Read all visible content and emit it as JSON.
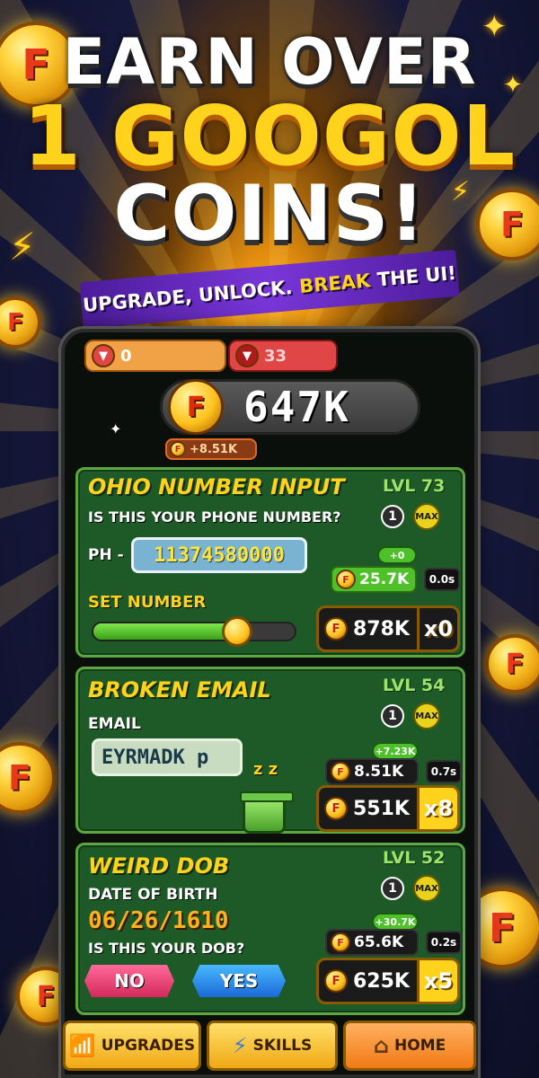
{
  "headline": {
    "line1": "EARN OVER",
    "line2": "1 GOOGOL",
    "line3": "COINS!",
    "banner_a": "UPGRADE, UNLOCK.",
    "banner_b": "BREAK",
    "banner_c": "THE UI!"
  },
  "coin_glyph": "F",
  "counters": {
    "orange_value": "0",
    "red_value": "33"
  },
  "balance": {
    "value": "647K",
    "rate": "+8.51K"
  },
  "cards": [
    {
      "title": "OHIO NUMBER INPUT",
      "level": "LVL 73",
      "question": "IS THIS YOUR PHONE NUMBER?",
      "count": "1",
      "max": "MAX",
      "phone_prefix": "PH -",
      "phone_value": "11374580000",
      "plus": "+0",
      "rate_cost": "25.7K",
      "time": "0.0s",
      "slider_label": "SET NUMBER",
      "slider_value": 0.71,
      "buy_cost": "878K",
      "multiplier": "x0"
    },
    {
      "title": "BROKEN EMAIL",
      "level": "LVL 54",
      "field_label": "EMAIL",
      "count": "1",
      "max": "MAX",
      "email_value": "EYRMADK p",
      "plus": "+7.23K",
      "rate_cost": "8.51K",
      "time": "0.7s",
      "zz": "z z",
      "buy_cost": "551K",
      "multiplier": "x8"
    },
    {
      "title": "WEIRD DOB",
      "level": "LVL 52",
      "field_label": "DATE OF BIRTH",
      "dob_value": "06/26/1610",
      "question": "IS THIS YOUR DOB?",
      "count": "1",
      "max": "MAX",
      "plus": "+30.7K",
      "rate_cost": "65.6K",
      "time": "0.2s",
      "buy_cost": "625K",
      "multiplier": "x5",
      "no_label": "NO",
      "yes_label": "YES"
    }
  ],
  "nav": {
    "upgrades": "UPGRADES",
    "skills": "SKILLS",
    "home": "HOME"
  },
  "icons": {
    "upgrades": "chart-up-icon",
    "skills": "lightning-icon",
    "home": "house-icon",
    "coin": "f-coin-icon",
    "trash": "trash-can-icon"
  },
  "colors": {
    "accent_gold": "#ffd21c",
    "card_green": "#1e5a28",
    "card_border": "#5ea640"
  }
}
